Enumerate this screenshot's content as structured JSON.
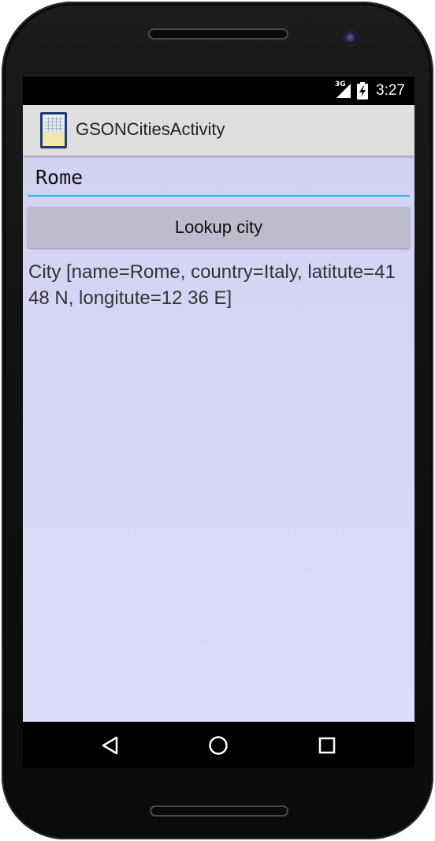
{
  "device": {
    "frame_color": "#111111"
  },
  "statusbar": {
    "network_label": "3G",
    "time": "3:27",
    "icons": [
      "signal-icon",
      "battery-charging-icon"
    ]
  },
  "actionbar": {
    "title": "GSONCitiesActivity",
    "icon": "app-icon"
  },
  "form": {
    "city_value": "Rome",
    "accent_color": "#33b5e5",
    "lookup_button_label": "Lookup city"
  },
  "result": {
    "text": "City [name=Rome, country=Italy, latitute=41 48 N, longitute=12 36 E]"
  },
  "navbar": {
    "icons": [
      "back-icon",
      "home-icon",
      "recents-icon"
    ]
  }
}
